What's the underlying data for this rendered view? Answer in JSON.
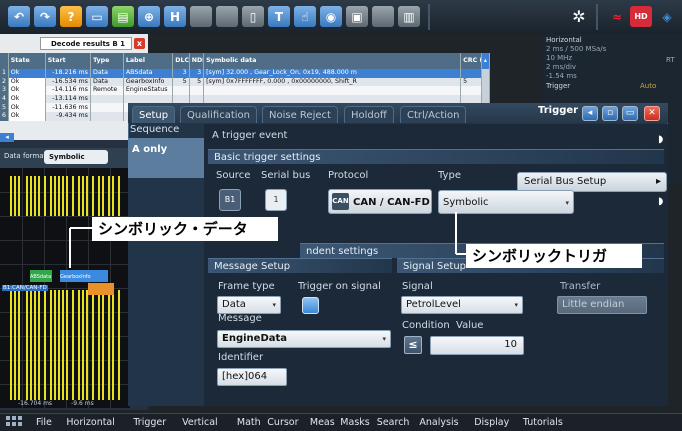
{
  "toolbar": {
    "buttons": [
      "undo-icon",
      "redo-icon",
      "help-icon",
      "bus-icon",
      "wizard-icon",
      "zoom-icon",
      "history-icon",
      "blank-icon",
      "blank-icon",
      "text-icon",
      "touch-icon",
      "screenshot-icon",
      "save-icon",
      "blank-icon",
      "delete-icon"
    ],
    "right_icons": [
      "settings-icon",
      "signal-icon",
      "hd-icon",
      "layout-icon"
    ]
  },
  "decode": {
    "tab_title": "Decode results B 1",
    "close_label": "x",
    "headers": [
      "State",
      "Start",
      "Type",
      "Label",
      "DLC",
      "NDB (dec)",
      "Symbolic data",
      "CRC (hex)"
    ],
    "rows": [
      [
        "Ok",
        "-18.216 ms",
        "Data",
        "ABSdata",
        "3",
        "3",
        "[sym] 32.000 , Gear_Lock_On, 0x19, 488.000 m",
        ""
      ],
      [
        "Ok",
        "-16.534 ms",
        "Data",
        "GearboxInfo",
        "5",
        "5",
        "[sym] 0x7FFFFFFF, 0.000 , 0x00000000, Shift_R",
        "5"
      ],
      [
        "Ok",
        "-14.116 ms",
        "Remote",
        "EngineStatus",
        "",
        "",
        "",
        ""
      ],
      [
        "Ok",
        "-13.114 ms",
        "",
        "",
        "",
        "",
        "",
        ""
      ],
      [
        "Ok",
        "-11.636 ms",
        "",
        "",
        "",
        "",
        "",
        ""
      ],
      [
        "Ok",
        "-9.434 ms",
        "",
        "",
        "",
        "",
        "",
        ""
      ]
    ],
    "row_numbers": [
      "1",
      "2",
      "3",
      "4",
      "5",
      "6"
    ]
  },
  "left": {
    "data_format_label": "Data format",
    "data_format_value": "Symbolic",
    "decoded_labels": [
      "ABSdata",
      "GearboxInfo"
    ],
    "bus_label": "B1:CAN/CAN-FD",
    "timestamps": "-16.704 ms          -9.6 ms"
  },
  "horizontal": {
    "title": "Horizontal",
    "lines": [
      "2 ms / 500 MSa/s",
      "10 MHz",
      "2 ms/div",
      "-1.54 ms"
    ],
    "rt": "RT",
    "trigger_title": "Trigger",
    "trigger_mode": "Auto"
  },
  "dialog": {
    "tabs": [
      "Setup",
      "Qualification",
      "Noise Reject",
      "Holdoff",
      "Ctrl/Action"
    ],
    "title": "Trigger",
    "sequence_label": "Sequence",
    "sequence_value": "A only",
    "event_label": "A trigger event",
    "basic_header": "Basic trigger settings",
    "serial_bus_setup": "Serial Bus Setup",
    "source_label": "Source",
    "serial_bus_label": "Serial bus",
    "protocol_label": "Protocol",
    "protocol_value": "CAN / CAN-FD",
    "protocol_icon_text": "CAN",
    "type_label": "Type",
    "type_value": "Symbolic",
    "dependent_header": "ndent settings",
    "message_setup_header": "Message Setup",
    "signal_setup_header": "Signal Setup",
    "frame_type_label": "Frame type",
    "frame_type_value": "Data",
    "trigger_on_signal_label": "Trigger on signal",
    "message_label": "Message",
    "message_value": "EngineData",
    "identifier_label": "Identifier",
    "identifier_value": "[hex]064",
    "signal_label": "Signal",
    "signal_value": "PetrolLevel",
    "condition_label": "Condition",
    "condition_value": "≤",
    "value_label": "Value",
    "value_value": "10",
    "transfer_label": "Transfer",
    "transfer_value": "Little endian"
  },
  "callouts": {
    "symbolic_data": "シンボリック・データ",
    "symbolic_trigger": "シンボリックトリガ"
  },
  "menu": [
    "File",
    "Horizontal",
    "Trigger",
    "Vertical",
    "Math",
    "Cursor",
    "Meas",
    "Masks",
    "Search",
    "Analysis",
    "Display",
    "Tutorials"
  ]
}
